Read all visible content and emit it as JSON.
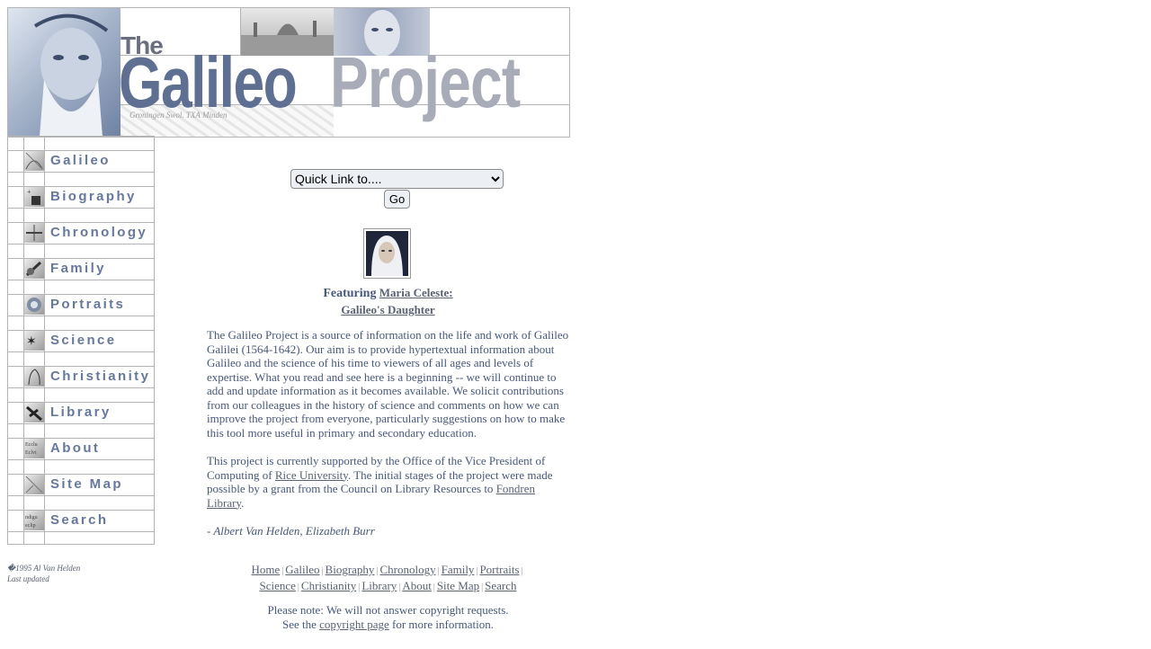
{
  "banner": {
    "title_the": "The",
    "title_galileo": "Galileo",
    "title_project": "Project",
    "map_label": "Groningen    Swol.  TXA  Minden"
  },
  "nav": {
    "items": [
      {
        "label": "Galileo",
        "icon": "galileo-thumb-icon"
      },
      {
        "label": "Biography",
        "icon": "biography-thumb-icon"
      },
      {
        "label": "Chronology",
        "icon": "chronology-thumb-icon"
      },
      {
        "label": "Family",
        "icon": "family-thumb-icon"
      },
      {
        "label": "Portraits",
        "icon": "portraits-thumb-icon"
      },
      {
        "label": "Science",
        "icon": "science-thumb-icon"
      },
      {
        "label": "Christianity",
        "icon": "christianity-thumb-icon"
      },
      {
        "label": "Library",
        "icon": "library-thumb-icon"
      },
      {
        "label": "About",
        "icon": "about-thumb-icon"
      },
      {
        "label": "Site Map",
        "icon": "sitemap-thumb-icon"
      },
      {
        "label": "Search",
        "icon": "search-thumb-icon"
      }
    ]
  },
  "quicklink": {
    "selected": "Quick Link to....",
    "go_label": "Go"
  },
  "feature": {
    "label": "Featuring",
    "link1": "Maria Celeste:",
    "link2": "Galileo's Daughter"
  },
  "intro": {
    "text": "The Galileo Project is a source of information on the life and work of Galileo Galilei (1564-1642). Our aim is to provide hypertextual information about Galileo and the science of his time to viewers of all ages and levels of expertise. What you read and see here is a beginning -- we will continue to add and update information as it becomes available. We solicit contributions from our colleagues in the history of science and comments on how we can improve the project from everyone, particularly suggestions on how to make this tool more useful in primary and secondary education."
  },
  "support": {
    "part1": "This project is currently supported by the Office of the Vice President of Computing of ",
    "link_rice": "Rice University",
    "part2": ". The initial stages of the project were made possible by a grant from the Council on Library Resources to ",
    "link_fondren": "Fondren Library",
    "part3": "."
  },
  "signature": "- Albert Van Helden, Elizabeth Burr",
  "footer": {
    "copyright": "�1995 Al Van Helden",
    "last_updated": "Last updated",
    "links_row1": [
      "Home",
      "Galileo",
      "Biography",
      "Chronology",
      "Family",
      "Portraits"
    ],
    "links_row2": [
      "Science",
      "Christianity",
      "Library",
      "About",
      "Site Map",
      "Search"
    ],
    "separator": "|",
    "notice_line1": "Please note: We will not answer copyright requests.",
    "notice_pre": "See the ",
    "notice_link": "copyright page",
    "notice_post": " for more information."
  }
}
